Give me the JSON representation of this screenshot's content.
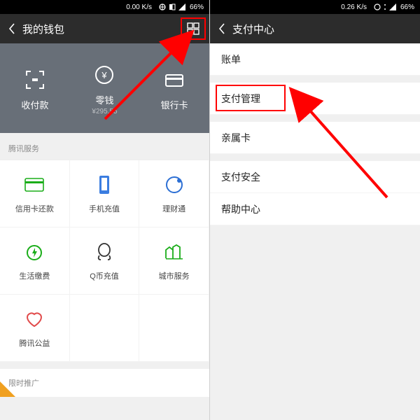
{
  "left": {
    "status": {
      "speed": "0.00 K/s",
      "battery": "66%"
    },
    "title": "我的钱包",
    "wallet_items": [
      {
        "label": "收付款"
      },
      {
        "label": "零钱",
        "sub": "¥295.55"
      },
      {
        "label": "银行卡"
      }
    ],
    "section1_title": "腾讯服务",
    "services": [
      {
        "label": "信用卡还款"
      },
      {
        "label": "手机充值"
      },
      {
        "label": "理财通"
      },
      {
        "label": "生活缴费"
      },
      {
        "label": "Q币充值"
      },
      {
        "label": "城市服务"
      },
      {
        "label": "腾讯公益"
      }
    ],
    "section2_title": "限时推广"
  },
  "right": {
    "status": {
      "speed": "0.26 K/s",
      "battery": "66%"
    },
    "title": "支付中心",
    "rows": [
      {
        "label": "账单"
      },
      {
        "label": "支付管理"
      },
      {
        "label": "亲属卡"
      },
      {
        "label": "支付安全"
      },
      {
        "label": "帮助中心"
      }
    ]
  }
}
